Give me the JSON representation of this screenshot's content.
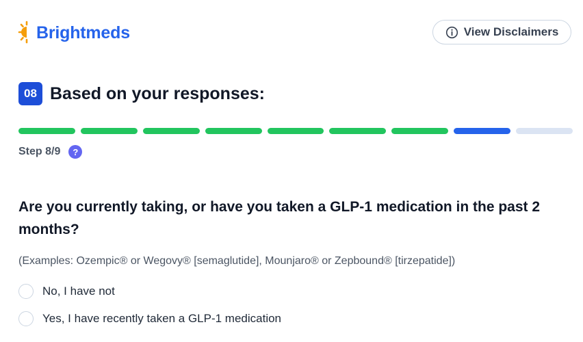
{
  "brand": {
    "name": "Brightmeds",
    "logo_icon": "sun-icon",
    "color": "#2563eb",
    "icon_color": "#f59e0b"
  },
  "header": {
    "disclaimer_label": "View Disclaimers",
    "disclaimer_icon": "info-icon"
  },
  "section": {
    "number": "08",
    "title": "Based on your responses:"
  },
  "progress": {
    "total_steps": 9,
    "completed_steps": 7,
    "current_step": 8,
    "colors": {
      "completed": "#22c55e",
      "current": "#2563eb",
      "upcoming": "#dbe4f3"
    }
  },
  "step": {
    "label": "Step 8/9",
    "help_icon": "question-icon",
    "help_symbol": "?"
  },
  "question": {
    "text": "Are you currently taking, or have you taken a GLP-1 medication in the past 2 months?",
    "examples": "(Examples: Ozempic® or Wegovy® [semaglutide], Mounjaro® or Zepbound® [tirzepatide])",
    "options": [
      {
        "label": "No, I have not",
        "selected": false
      },
      {
        "label": "Yes, I have recently taken a GLP-1 medication",
        "selected": false
      }
    ]
  }
}
